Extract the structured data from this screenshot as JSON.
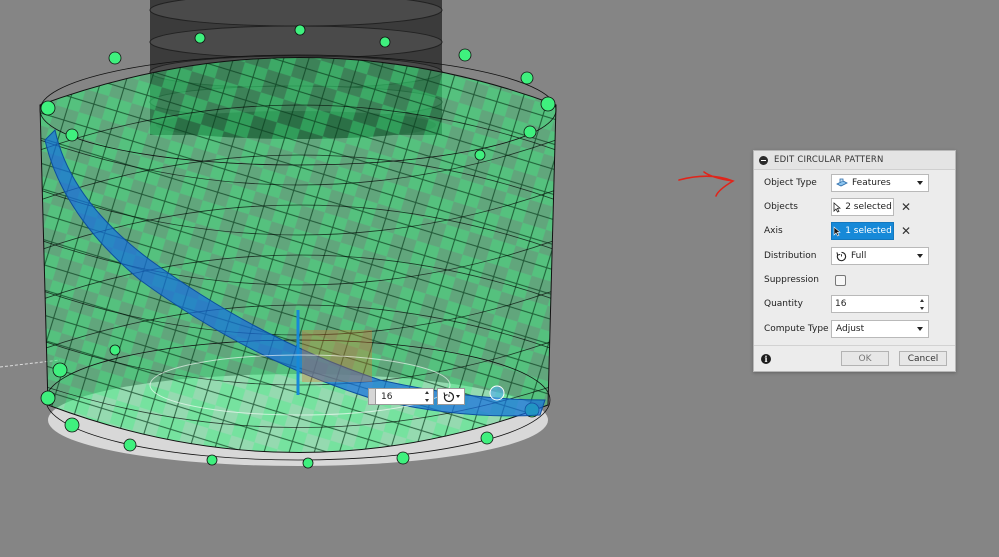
{
  "dialog": {
    "title": "EDIT CIRCULAR PATTERN",
    "rows": {
      "object_type": {
        "label": "Object Type",
        "value": "Features"
      },
      "objects": {
        "label": "Objects",
        "value": "2 selected"
      },
      "axis": {
        "label": "Axis",
        "value": "1 selected"
      },
      "distribution": {
        "label": "Distribution",
        "value": "Full"
      },
      "suppression": {
        "label": "Suppression"
      },
      "quantity": {
        "label": "Quantity",
        "value": "16"
      },
      "compute_type": {
        "label": "Compute Type",
        "value": "Adjust"
      }
    },
    "ok_label": "OK",
    "cancel_label": "Cancel"
  },
  "canvas_hud": {
    "quantity_value": "16"
  },
  "colors": {
    "viewport_bg": "#858585",
    "pattern_green": "#2fe36f",
    "axis_blue": "#1689d8",
    "arrow_red": "#e0251b"
  },
  "icons": {
    "collapse": "collapse-icon",
    "features": "features-icon",
    "cursor": "cursor-select-icon",
    "clear": "clear-x-icon",
    "distribution": "full-rotation-icon",
    "info": "info-icon",
    "direction": "direction-icon"
  }
}
